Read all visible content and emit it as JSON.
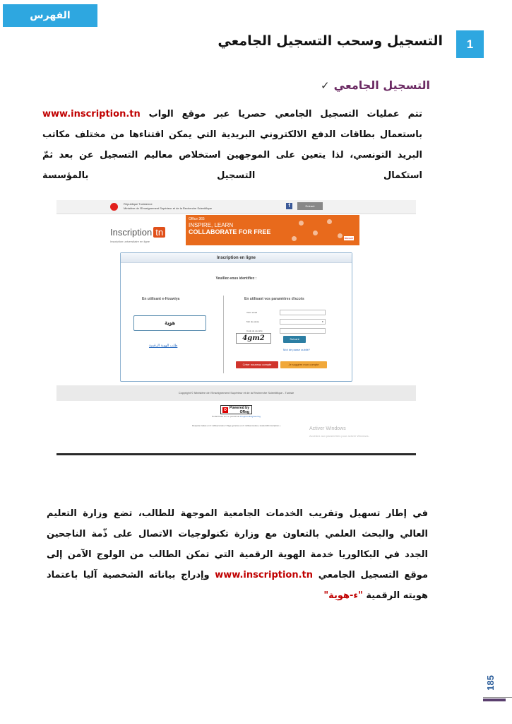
{
  "header": {
    "index_tab": "الفهرس",
    "section_number": "1",
    "section_title": "التسجيل وسحب التسجيل الجامعي"
  },
  "subsection": {
    "check_symbol": "✓",
    "title": "التسجيل الجامعي"
  },
  "paragraph1": {
    "part_a": "تتم عمليات التسجيل الجامعي حصريا عبر موقع الواب ",
    "link": "www.inscription.tn",
    "part_b": " باستعمال بطاقات الدفع الالكتروني البريدية التي يمكن اقتناءها من مختلف مكاتب البريد التونسي، لذا يتعين على الموجهين استخلاص معاليم التسجيل عن بعد ثمّ استكمال التسجيل بالمؤسسة"
  },
  "screenshot": {
    "republic": "République Tunisienne",
    "ministry": "Ministère de l'Enseignement Supérieur et de la Recherche Scientifique",
    "enter_button": "Entrant",
    "logo_text": "Inscription",
    "logo_tn": "tn",
    "logo_sub": "Inscription universitaire en ligne",
    "banner_office": "Office 365",
    "banner_line1": "INSPIRE, LEARN",
    "banner_line2": "COLLABORATE FOR FREE",
    "banner_microsoft": "Microsoft",
    "panel_title": "Inscription en ligne",
    "identify": "Veuillez-vous identifiez :",
    "left_heading": "En utilisant e-Houwiya",
    "houwiya_label": "هوية",
    "houwiya_link": "طلب الهوية الرقمية",
    "right_heading": "En utilisant vos paramètres d'accès",
    "email_label": "Votre email",
    "password_label": "Mot de passe",
    "security_label": "Code de sécurité",
    "captcha": "4gm2",
    "submit": "Suivant",
    "forgot": "Mot de passe oublié?",
    "new_account": "Créer nouveau compte",
    "suggest": "Je suggère mon compte",
    "copyright": "Copyright © Ministère de l'Enseignement Supérieur et de la Recherche Scientifique - Tunisie",
    "powered_by": "Powered by",
    "oreg": "OReg",
    "portail": "Portail basé sur un produit de ",
    "portail_link": "Progress Engineering",
    "requete": "Requête traitée en 0 millisecondes / Page générée en 0 millisecondes ( student26.inscription )",
    "activate_title": "Activer Windows",
    "activate_sub": "Accédez aux paramètres pour activer Windows."
  },
  "paragraph2": {
    "text": "في إطار تسهيل وتقريب الخدمات الجامعية الموجهة للطالب، تضع وزارة التعليم العالي والبحث العلمي بالتعاون مع وزارة تكنولوجيات الاتصال على ذّمة الناجحين الجدد في البكالوريا خدمة الهوية الرقمية التي تمكن الطالب من الولوج الآمن إلى موقع التسجيل الجامعي ",
    "link": "www.inscription.tn",
    "part_b": " وإدراج بياناته الشخصية آليا باعتماد هويته الرقمية ",
    "ehouwiya": "\"ء-هوية\""
  },
  "footer": {
    "page_number": "185"
  },
  "colors": {
    "accent_blue": "#2ea7e0",
    "subhead_purple": "#6b2a63",
    "link_red": "#c00000"
  }
}
